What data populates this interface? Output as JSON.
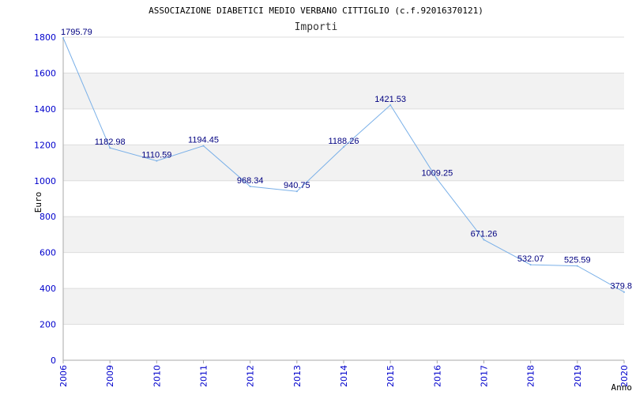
{
  "chart_data": {
    "type": "line",
    "title": "ASSOCIAZIONE DIABETICI MEDIO VERBANO CITTIGLIO (c.f.92016370121)",
    "subtitle": "Importi",
    "xlabel": "Anno",
    "ylabel": "Euro",
    "categories": [
      "2006",
      "2009",
      "2010",
      "2011",
      "2012",
      "2013",
      "2014",
      "2015",
      "2016",
      "2017",
      "2018",
      "2019",
      "2020"
    ],
    "values": [
      1795.79,
      1182.98,
      1110.59,
      1194.45,
      968.34,
      940.75,
      1188.26,
      1421.53,
      1009.25,
      671.26,
      532.07,
      525.59,
      379.8
    ],
    "value_labels": [
      "1795.79",
      "1182.98",
      "1110.59",
      "1194.45",
      "968.34",
      "940.75",
      "1188.26",
      "1421.53",
      "1009.25",
      "671.26",
      "532.07",
      "525.59",
      "379.8"
    ],
    "ylim": [
      0,
      1800
    ],
    "yticks": [
      "0",
      "200",
      "400",
      "600",
      "800",
      "1000",
      "1200",
      "1400",
      "1600",
      "1800"
    ],
    "grid": "horizontal alternating bands",
    "legend": "none",
    "colors": {
      "line": "#7ab0e8",
      "tick_labels": "#0000cc",
      "data_labels": "#000080",
      "band": "#f2f2f2",
      "gridline": "#dddddd",
      "axis": "#aaaaaa"
    }
  }
}
